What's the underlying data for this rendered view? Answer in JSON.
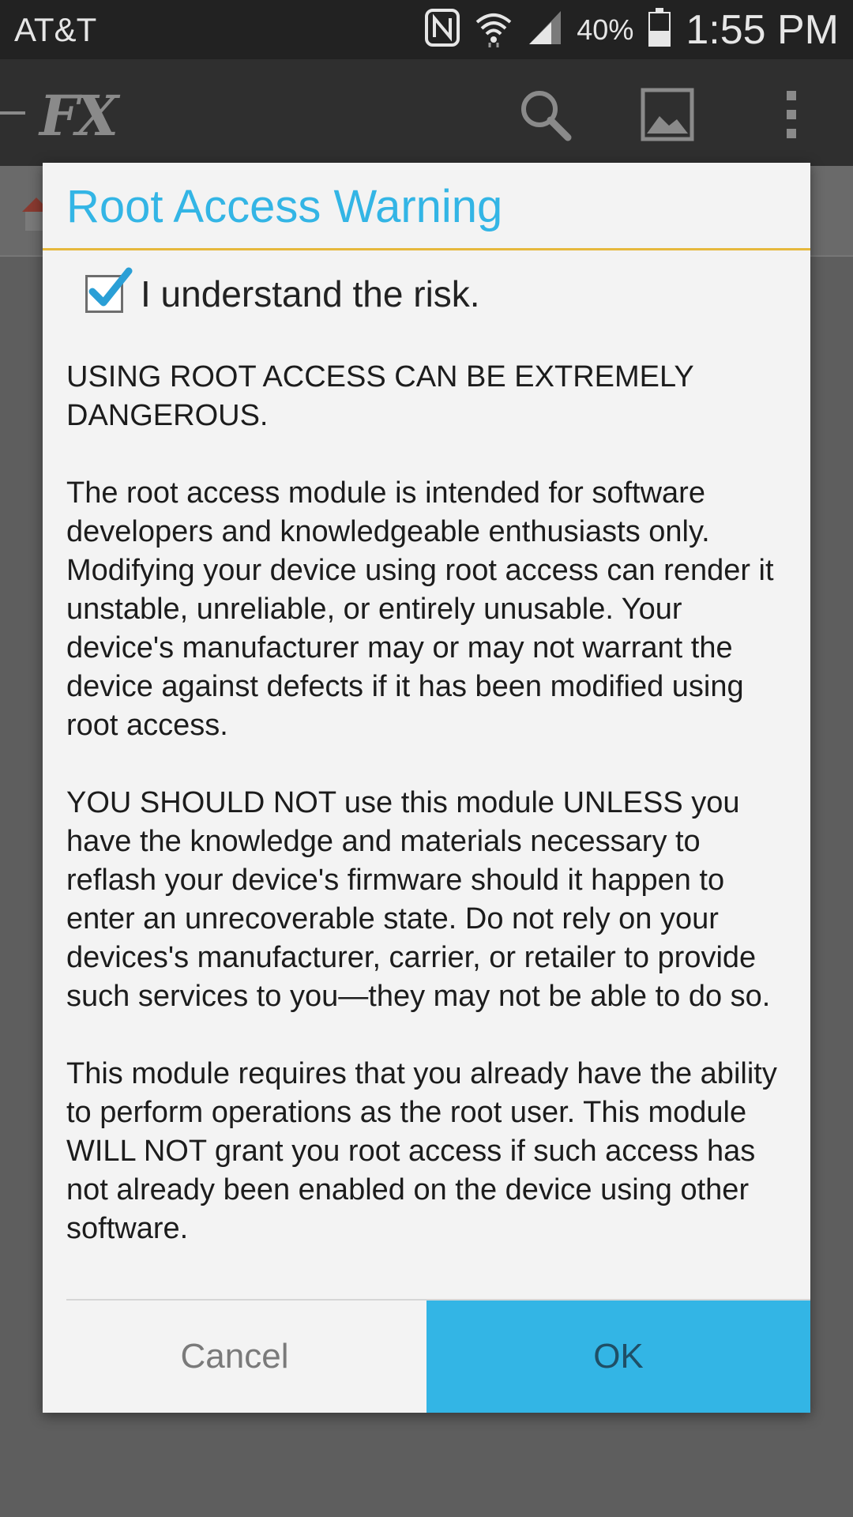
{
  "status_bar": {
    "carrier": "AT&T",
    "battery_percent": "40%",
    "time": "1:55 PM",
    "icons": [
      "nfc-icon",
      "wifi-icon",
      "signal-icon",
      "battery-icon"
    ]
  },
  "action_bar": {
    "app_logo": "FX",
    "icons": [
      "search-icon",
      "image-icon",
      "overflow-menu-icon"
    ]
  },
  "dialog": {
    "title": "Root Access Warning",
    "checkbox": {
      "label": "I understand the risk.",
      "checked": true
    },
    "paragraphs": [
      "USING ROOT ACCESS CAN BE EXTREMELY DANGEROUS.",
      "The root access module is intended for software developers and knowledgeable enthusiasts only. Modifying your device using root access can render it unstable, unreliable, or entirely unusable. Your device's manufacturer may or may not warrant the device against defects if it has been modified using root access.",
      "YOU SHOULD NOT use this module UNLESS you have the knowledge and materials necessary to reflash your device's firmware should it happen to enter an unrecoverable state. Do not rely on your devices's manufacturer, carrier, or retailer to provide such services to you—they may not be able to do so.",
      "This module requires that you already have the ability to perform operations as the root user. This module WILL NOT grant you root access if such access has not already been enabled on the device using other software."
    ],
    "buttons": {
      "cancel": "Cancel",
      "ok": "OK"
    }
  },
  "colors": {
    "accent": "#33b5e5",
    "title_divider": "#e6b83c",
    "dialog_bg": "#f3f3f3"
  }
}
